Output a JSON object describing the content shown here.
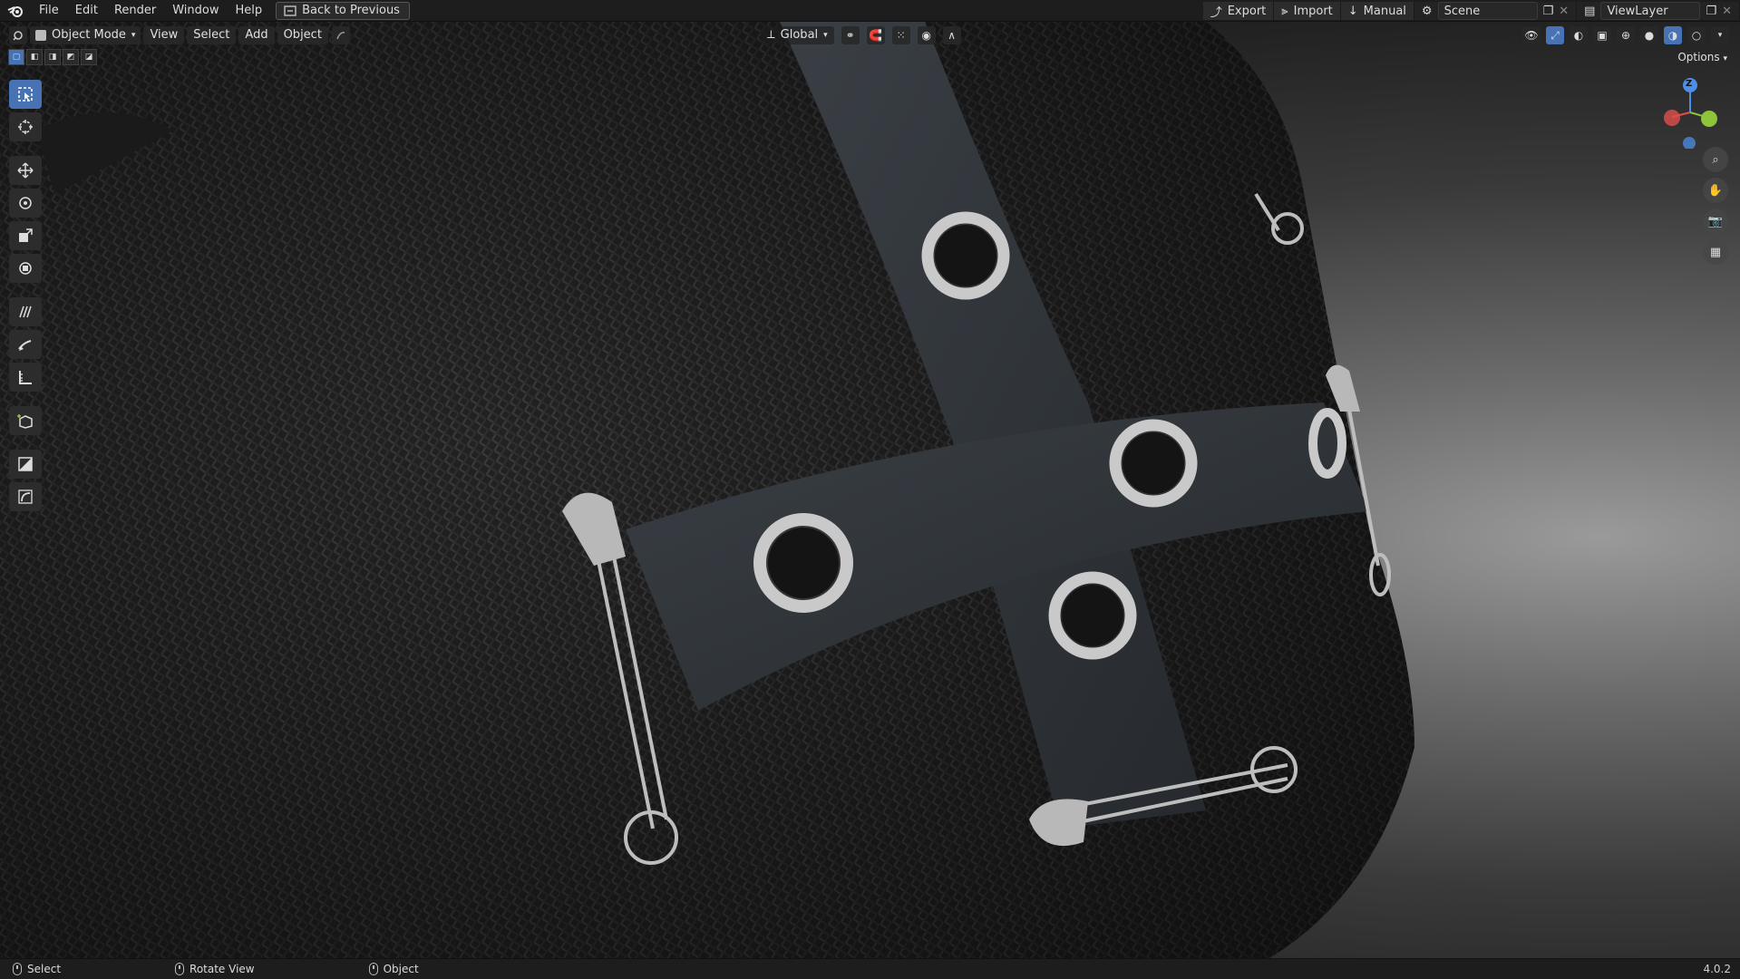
{
  "menu": {
    "items": [
      "File",
      "Edit",
      "Render",
      "Window",
      "Help"
    ],
    "back_button": "Back to Previous"
  },
  "topbar_right": {
    "export_label": "Export",
    "import_label": "Import",
    "manual_label": "Manual",
    "scene_name": "Scene",
    "view_layer": "ViewLayer"
  },
  "viewport_header": {
    "mode": "Object Mode",
    "menus": [
      "View",
      "Select",
      "Add",
      "Object"
    ],
    "transform_orientation": "Global",
    "options_label": "Options"
  },
  "gizmo": {
    "z_label": "Z",
    "x_color": "#e0504b",
    "y_color": "#8fc43a",
    "z_color": "#4d8ee8"
  },
  "toolbar": {
    "tools": [
      "select-box-icon",
      "cursor-icon",
      "move-icon",
      "rotate-icon",
      "scale-icon",
      "transform-icon",
      "annotate-icon",
      "draw-icon",
      "measure-icon",
      "add-cube-icon",
      "shader-icon",
      "curve-icon"
    ]
  },
  "statusbar": {
    "select_label": "Select",
    "rotate_label": "Rotate View",
    "object_label": "Object",
    "version": "4.0.2"
  },
  "colors": {
    "accent": "#4772b3",
    "ui_bg": "#1d1d1d"
  }
}
